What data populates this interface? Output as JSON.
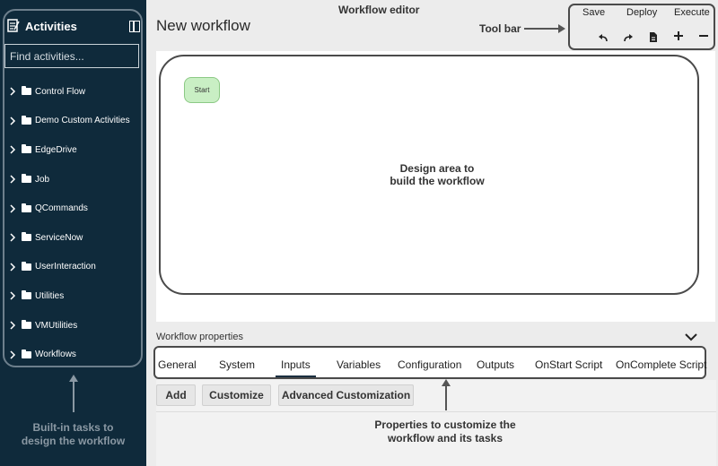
{
  "sidebar": {
    "title": "Activities",
    "search_placeholder": "Find activities...",
    "items": [
      {
        "label": "Control Flow"
      },
      {
        "label": "Demo Custom Activities"
      },
      {
        "label": "EdgeDrive"
      },
      {
        "label": "Job"
      },
      {
        "label": "QCommands"
      },
      {
        "label": "ServiceNow"
      },
      {
        "label": "UserInteraction"
      },
      {
        "label": "Utilities"
      },
      {
        "label": "VMUtilities"
      },
      {
        "label": "Workflows"
      }
    ],
    "caption_line1": "Built-in tasks to",
    "caption_line2": "design the workflow"
  },
  "header": {
    "editor_label": "Workflow editor",
    "title": "New workflow"
  },
  "toolbar": {
    "caption": "Tool bar",
    "save": "Save",
    "deploy": "Deploy",
    "execute": "Execute",
    "icons": [
      "undo-icon",
      "redo-icon",
      "document-icon",
      "zoom-in-icon",
      "zoom-out-icon"
    ]
  },
  "canvas": {
    "start_node": "Start",
    "label_line1": "Design area to",
    "label_line2": "build the workflow"
  },
  "properties": {
    "title": "Workflow properties",
    "tabs": [
      {
        "label": "General"
      },
      {
        "label": "System"
      },
      {
        "label": "Inputs"
      },
      {
        "label": "Variables"
      },
      {
        "label": "Configuration"
      },
      {
        "label": "Outputs"
      },
      {
        "label": "OnStart Script"
      },
      {
        "label": "OnComplete Script"
      }
    ],
    "active_tab": "Inputs",
    "buttons": {
      "add": "Add",
      "customize": "Customize",
      "advanced": "Advanced Customization"
    },
    "caption_line1": "Properties to customize the",
    "caption_line2": "workflow and its tasks"
  },
  "colors": {
    "sidebar_bg": "#0f2a3b",
    "start_node": "#c9efc4",
    "main_bg": "#ececec"
  }
}
